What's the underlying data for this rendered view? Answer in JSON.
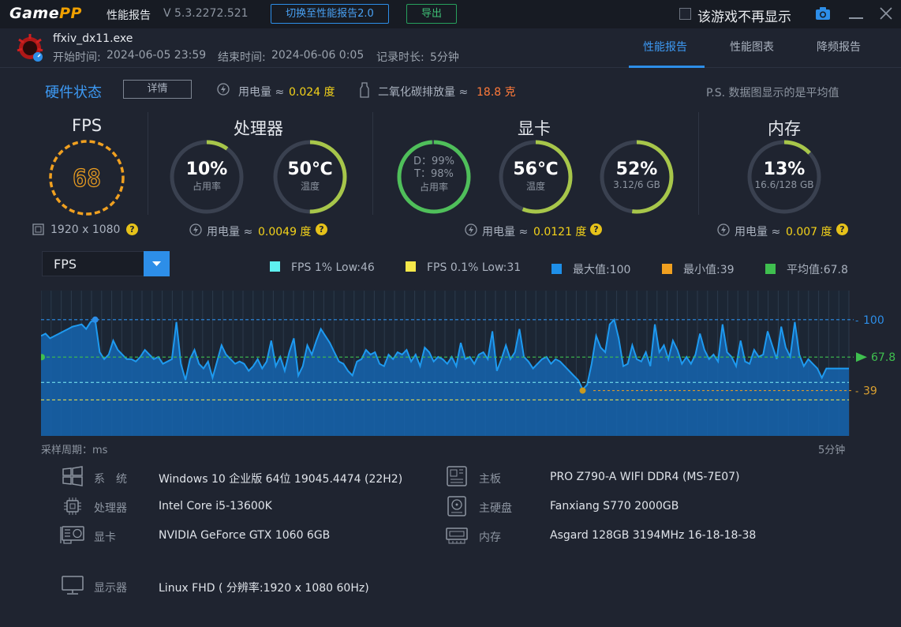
{
  "titlebar": {
    "logo_game": "Game",
    "logo_pp": "PP",
    "title": "性能报告",
    "version": "V 5.3.2272.521",
    "switch_button": "切换至性能报告2.0",
    "export_button": "导出",
    "no_show_label": "该游戏不再显示"
  },
  "header": {
    "exe": "ffxiv_dx11.exe",
    "start_label": "开始时间:",
    "start_time": "2024-06-05 23:59",
    "end_label": "结束时间:",
    "end_time": "2024-06-06 0:05",
    "duration_label": "记录时长:",
    "duration": "5分钟",
    "tabs": [
      "性能报告",
      "性能图表",
      "降频报告"
    ],
    "active_tab": 0
  },
  "hardware": {
    "title": "硬件状态",
    "detail_button": "详情",
    "power_label": "用电量 ≈",
    "power_value": "0.024 度",
    "co2_label": "二氧化碳排放量 ≈",
    "co2_value": "18.8 克",
    "ps_note": "P.S. 数据图显示的是平均值"
  },
  "groups": {
    "fps": {
      "title": "FPS",
      "value": "68",
      "resolution": "1920 x 1080"
    },
    "cpu": {
      "title": "处理器",
      "usage": {
        "value": "10%",
        "label": "占用率",
        "fill": 0.1
      },
      "temp": {
        "value": "50℃",
        "label": "温度",
        "fill": 0.5
      },
      "power_label": "用电量 ≈",
      "power_value": "0.0049 度"
    },
    "gpu": {
      "title": "显卡",
      "usage": {
        "line1": "D：99%",
        "line2": "T：98%",
        "label": "占用率",
        "fill": 0.99
      },
      "temp": {
        "value": "56℃",
        "label": "温度",
        "fill": 0.56
      },
      "vram": {
        "value": "52%",
        "label": "3.12/6 GB",
        "fill": 0.52
      },
      "power_label": "用电量 ≈",
      "power_value": "0.0121 度"
    },
    "mem": {
      "title": "内存",
      "usage": {
        "value": "13%",
        "label": "16.6/128 GB",
        "fill": 0.13
      },
      "power_label": "用电量 ≈",
      "power_value": "0.007 度"
    }
  },
  "chart_controls": {
    "selected": "FPS",
    "legend": [
      {
        "label": "FPS 1% Low:46",
        "color": "#5ef0f0"
      },
      {
        "label": "FPS 0.1% Low:31",
        "color": "#f5e84a"
      },
      {
        "label": "最大值:100",
        "color": "#1e8fe8"
      },
      {
        "label": "最小值:39",
        "color": "#f0a020"
      },
      {
        "label": "平均值:67.8",
        "color": "#3fbf4f"
      }
    ]
  },
  "chart_data": {
    "type": "area",
    "ylim": [
      0,
      125
    ],
    "ref_lines": {
      "max": 100,
      "avg": 67.8,
      "min": 39,
      "low1": 46,
      "low01": 31
    },
    "labels": {
      "max": "100",
      "avg": "67.8",
      "min": "39"
    },
    "xlabel_left": "采样周期：ms",
    "xlabel_right": "5分钟",
    "values": [
      86,
      88,
      84,
      86,
      88,
      90,
      92,
      94,
      95,
      96,
      92,
      98,
      100,
      72,
      66,
      70,
      82,
      74,
      70,
      66,
      66,
      64,
      68,
      74,
      70,
      66,
      68,
      62,
      64,
      66,
      98,
      62,
      48,
      66,
      74,
      62,
      58,
      64,
      50,
      64,
      78,
      70,
      66,
      62,
      64,
      62,
      56,
      60,
      66,
      58,
      64,
      82,
      60,
      68,
      56,
      72,
      84,
      52,
      60,
      78,
      70,
      82,
      92,
      86,
      80,
      72,
      64,
      62,
      56,
      52,
      64,
      66,
      74,
      70,
      72,
      62,
      60,
      70,
      66,
      72,
      70,
      74,
      64,
      70,
      60,
      76,
      72,
      64,
      68,
      66,
      62,
      68,
      60,
      80,
      66,
      68,
      62,
      70,
      72,
      66,
      90,
      56,
      66,
      78,
      66,
      72,
      92,
      68,
      64,
      58,
      62,
      66,
      68,
      62,
      66,
      64,
      60,
      56,
      52,
      48,
      40,
      44,
      62,
      86,
      76,
      72,
      96,
      100,
      84,
      60,
      62,
      78,
      66,
      64,
      72,
      60,
      96,
      72,
      78,
      66,
      82,
      74,
      62,
      68,
      62,
      70,
      88,
      74,
      66,
      70,
      64,
      96,
      72,
      68,
      60,
      82,
      64,
      62,
      74,
      68,
      70,
      90,
      78,
      66,
      94,
      76,
      68,
      98,
      70,
      60,
      66,
      62,
      58,
      50,
      58,
      58,
      58,
      58,
      58,
      58
    ]
  },
  "specs": [
    {
      "key": "系　统",
      "value": "Windows 10 企业版 64位 19045.4474 (22H2)",
      "icon": "windows-icon"
    },
    {
      "key": "主板",
      "value": "PRO Z790-A WIFI DDR4 (MS-7E07)",
      "icon": "motherboard-icon"
    },
    {
      "key": "处理器",
      "value": "Intel Core i5-13600K",
      "icon": "cpu-icon"
    },
    {
      "key": "主硬盘",
      "value": "Fanxiang S770 2000GB",
      "icon": "harddisk-icon"
    },
    {
      "key": "显卡",
      "value": "NVIDIA GeForce GTX 1060 6GB",
      "icon": "gpu-icon"
    },
    {
      "key": "内存",
      "value": "Asgard 128GB 3194MHz 16-18-18-38",
      "icon": "memory-icon"
    },
    {
      "key": "显示器",
      "value": "Linux FHD ( 分辨率:1920 x 1080 60Hz)",
      "icon": "monitor-icon"
    }
  ]
}
